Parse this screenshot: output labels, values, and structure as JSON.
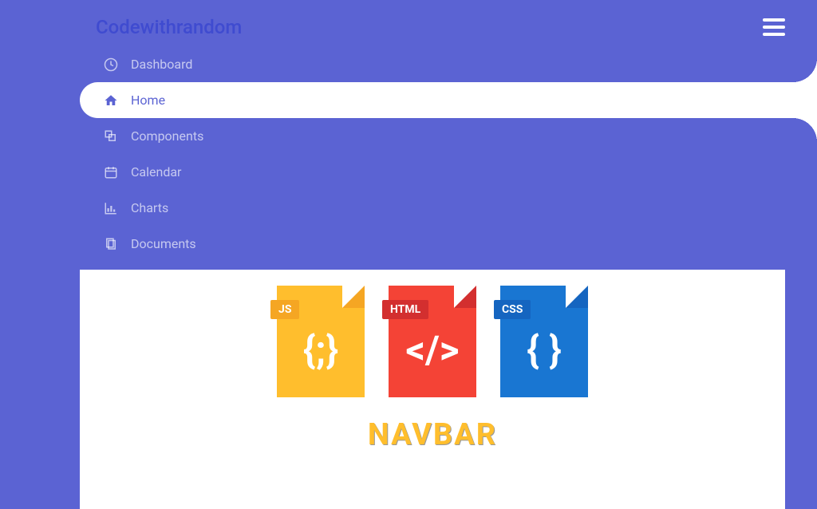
{
  "header": {
    "brand": "Codewithrandom"
  },
  "sidebar": {
    "items": [
      {
        "label": "Dashboard",
        "icon": "dashboard-icon",
        "active": false
      },
      {
        "label": "Home",
        "icon": "home-icon",
        "active": true
      },
      {
        "label": "Components",
        "icon": "components-icon",
        "active": false
      },
      {
        "label": "Calendar",
        "icon": "calendar-icon",
        "active": false
      },
      {
        "label": "Charts",
        "icon": "charts-icon",
        "active": false
      },
      {
        "label": "Documents",
        "icon": "documents-icon",
        "active": false
      }
    ]
  },
  "content": {
    "files": [
      {
        "label": "JS",
        "type": "js"
      },
      {
        "label": "HTML",
        "type": "html"
      },
      {
        "label": "CSS",
        "type": "css"
      }
    ],
    "title": "NAVBAR"
  }
}
